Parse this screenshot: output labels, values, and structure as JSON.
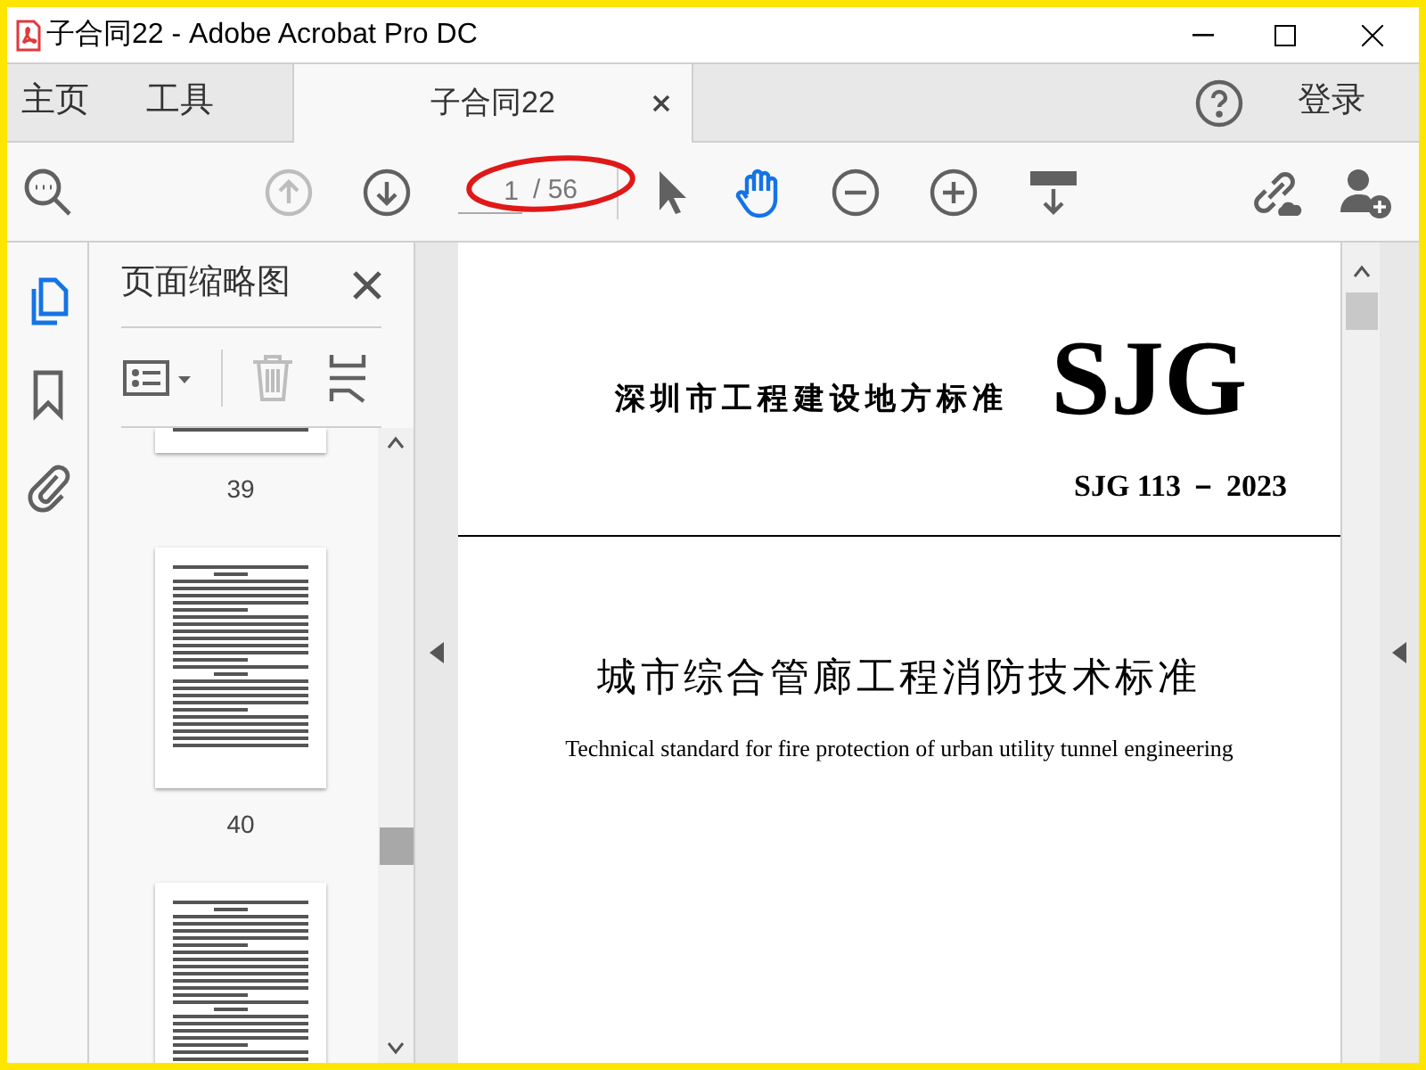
{
  "window": {
    "title": "子合同22 - Adobe Acrobat Pro DC"
  },
  "tabs": [
    {
      "label": "主页",
      "selected": false
    },
    {
      "label": "工具",
      "selected": false
    },
    {
      "label": "子合同22",
      "selected": true
    }
  ],
  "signin": "登录",
  "toolbar": {
    "prev_disabled": true,
    "page_input": "1",
    "page_total": "/ 56",
    "hand_selected": true
  },
  "rail": [
    {
      "kind": "pages",
      "selected": true
    },
    {
      "kind": "bookmark",
      "selected": false
    },
    {
      "kind": "attachment",
      "selected": false
    }
  ],
  "sidebar": {
    "title": "页面缩略图",
    "thumbnails": [
      {
        "label": "39",
        "partial": true
      },
      {
        "label": "40",
        "partial": false
      },
      {
        "partial": false
      }
    ]
  },
  "document": {
    "org": "深圳市工程建设地方标准",
    "logo": "SJG",
    "code": "SJG 113 － 2023",
    "title": "城市综合管廊工程消防技术标准",
    "subtitle": "Technical standard for fire protection of urban utility tunnel engineering"
  }
}
